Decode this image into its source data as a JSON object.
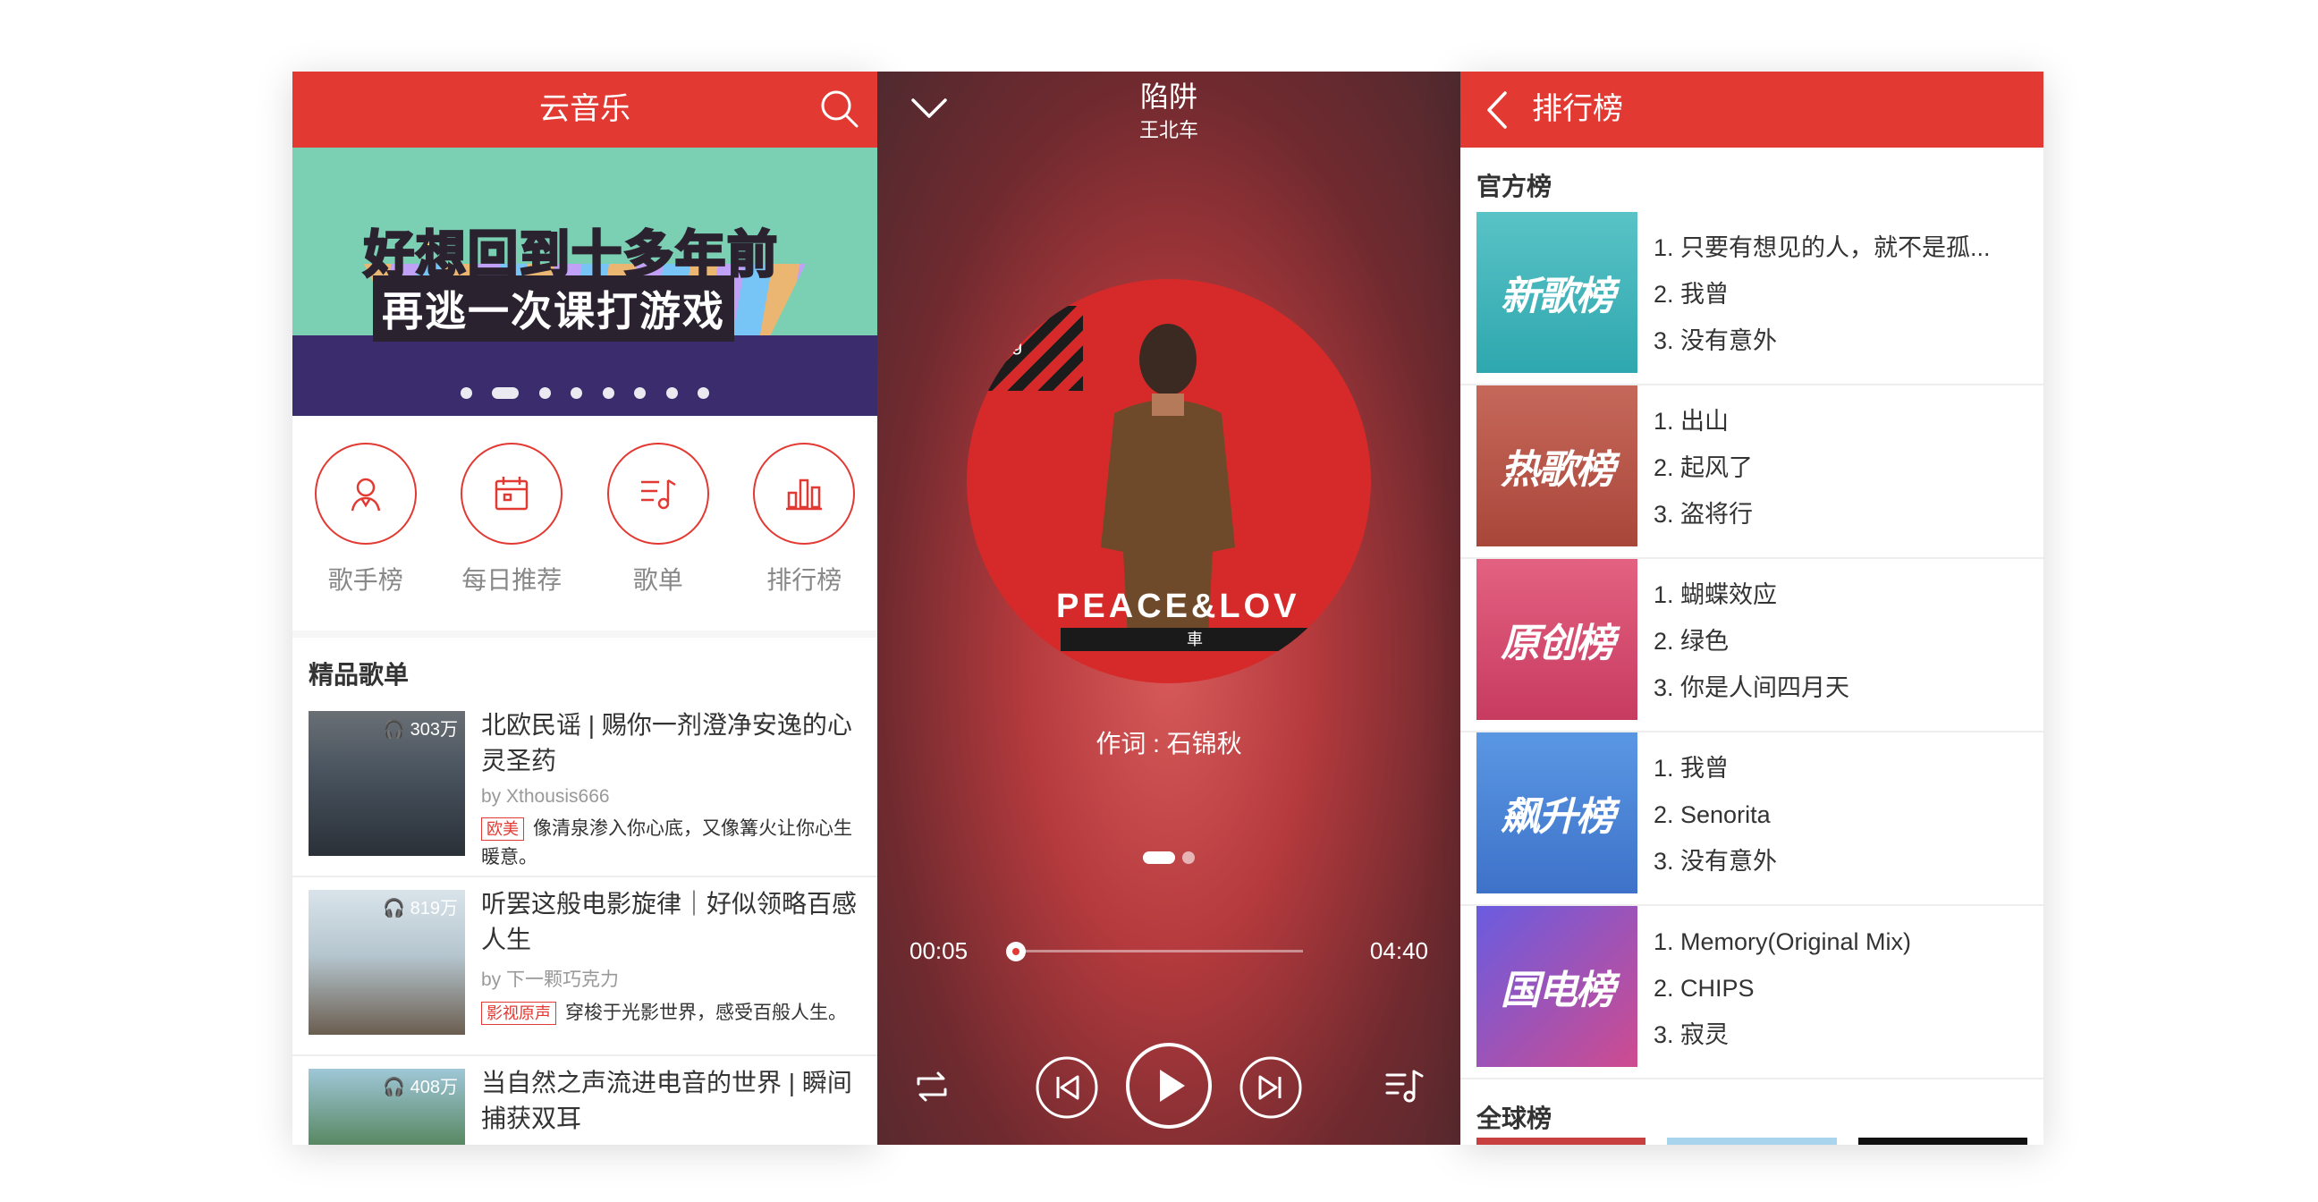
{
  "home": {
    "title": "云音乐",
    "banner": {
      "line1": "好想回到十多年前",
      "line2": "再逃一次课打游戏"
    },
    "quick": [
      {
        "label": "歌手榜",
        "icon": "singer-icon"
      },
      {
        "label": "每日推荐",
        "icon": "calendar-icon"
      },
      {
        "label": "歌单",
        "icon": "playlist-icon"
      },
      {
        "label": "排行榜",
        "icon": "chart-icon"
      }
    ],
    "section_title": "精品歌单",
    "playlists": [
      {
        "plays": "303万",
        "name": "北欧民谣 | 赐你一剂澄净安逸的心灵圣药",
        "author": "by Xthousis666",
        "tag": "欧美",
        "desc": "像清泉渗入你心底，又像篝火让你心生暖意。"
      },
      {
        "plays": "819万",
        "name": "听罢这般电影旋律｜好似领略百感人生",
        "author": "by 下一颗巧克力",
        "tag": "影视原声",
        "desc": "穿梭于光影世界，感受百般人生。"
      },
      {
        "plays": "408万",
        "name": "当自然之声流进电音的世界 | 瞬间捕获双耳"
      }
    ]
  },
  "player": {
    "song": "陷阱",
    "artist": "王北车",
    "cover_text": "PEACE&LOV",
    "cover_bar": "車",
    "cover_corner": "ying",
    "lyric": "作词 : 石锦秋",
    "current_time": "00:05",
    "total_time": "04:40",
    "progress": 0.02
  },
  "charts": {
    "title": "排行榜",
    "official_title": "官方榜",
    "global_title": "全球榜",
    "lists": [
      {
        "cover": "新歌榜",
        "songs": [
          "1. 只要有想见的人，就不是孤...",
          "2. 我曾",
          "3. 没有意外"
        ]
      },
      {
        "cover": "热歌榜",
        "songs": [
          "1. 出山",
          "2. 起风了",
          "3. 盗将行"
        ]
      },
      {
        "cover": "原创榜",
        "songs": [
          "1. 蝴蝶效应",
          "2. 绿色",
          "3. 你是人间四月天"
        ]
      },
      {
        "cover": "飙升榜",
        "songs": [
          "1. 我曾",
          "2. Senorita",
          "3. 没有意外"
        ]
      },
      {
        "cover": "国电榜",
        "songs": [
          "1. Memory(Original Mix)",
          "2. CHIPS",
          "3. 寂灵"
        ]
      }
    ]
  },
  "colors": {
    "accent": "#e23a33"
  }
}
